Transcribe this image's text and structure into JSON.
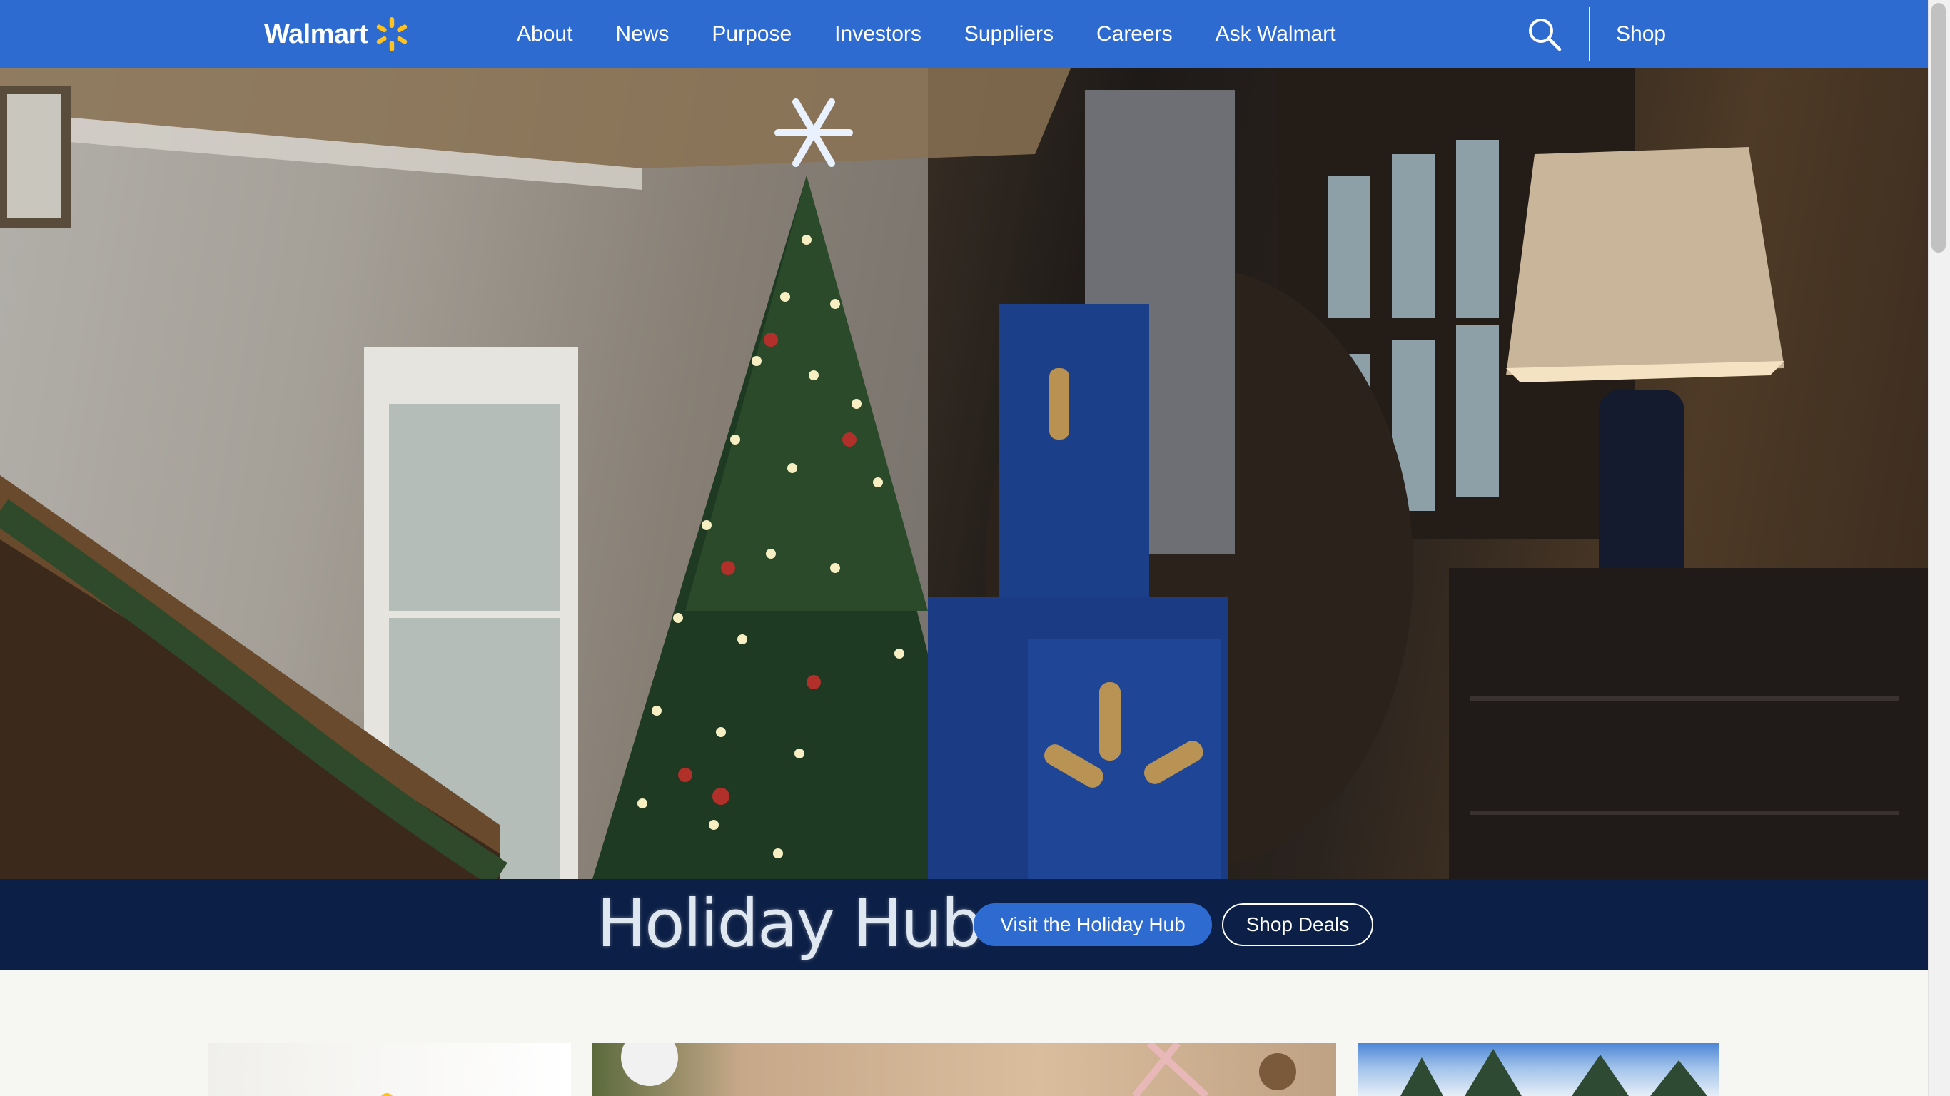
{
  "header": {
    "brand": "Walmart",
    "logo_icon": "walmart-spark-icon",
    "nav": [
      "About",
      "News",
      "Purpose",
      "Investors",
      "Suppliers",
      "Careers",
      "Ask Walmart"
    ],
    "search_icon": "search-icon",
    "shop_label": "Shop",
    "colors": {
      "bar": "#2e6bd1",
      "spark": "#ffc220"
    }
  },
  "hero": {
    "description_icon": "hero-video-icon"
  },
  "holiday": {
    "title": "Holiday Hub",
    "primary_button": "Visit the Holiday Hub",
    "secondary_button": "Shop Deals",
    "colors": {
      "bar": "#0c1f46"
    }
  },
  "cards": [
    {
      "name": "card-promo-1"
    },
    {
      "name": "card-promo-2"
    },
    {
      "name": "card-promo-3"
    }
  ]
}
